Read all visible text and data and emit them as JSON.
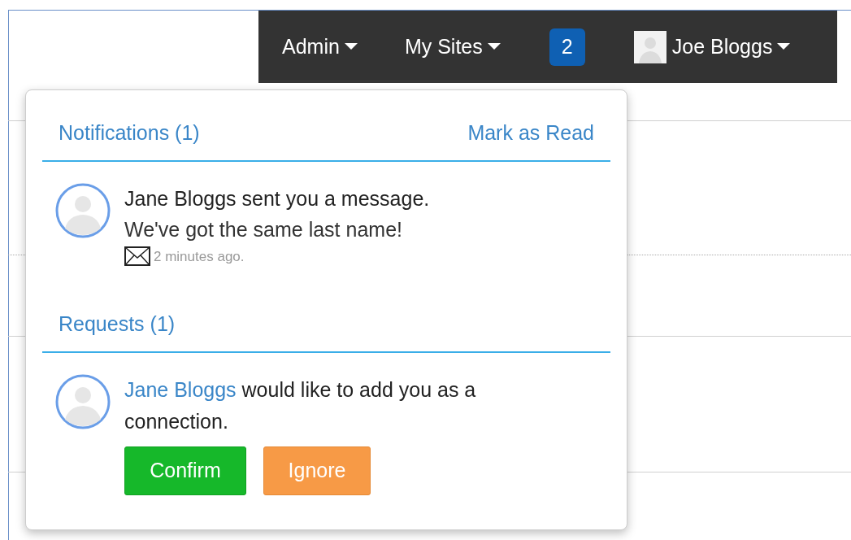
{
  "navbar": {
    "items": [
      {
        "kind": "menu",
        "label": "Admin"
      },
      {
        "kind": "menu",
        "label": "My Sites"
      },
      {
        "kind": "badge",
        "label": "2"
      },
      {
        "kind": "user",
        "label": "Joe Bloggs"
      }
    ]
  },
  "notifications": {
    "title": "Notifications (1)",
    "action": "Mark as Read",
    "items": [
      {
        "text": "Jane Bloggs sent you a message.",
        "message": "We've got the same last name!",
        "time": "2 minutes ago."
      }
    ]
  },
  "requests": {
    "title": "Requests (1)",
    "items": [
      {
        "name": "Jane Bloggs",
        "text": "would like to add you as a connection.",
        "buttons": [
          {
            "kind": "confirm",
            "label": "Confirm"
          },
          {
            "kind": "ignore",
            "label": "Ignore"
          }
        ]
      }
    ]
  }
}
